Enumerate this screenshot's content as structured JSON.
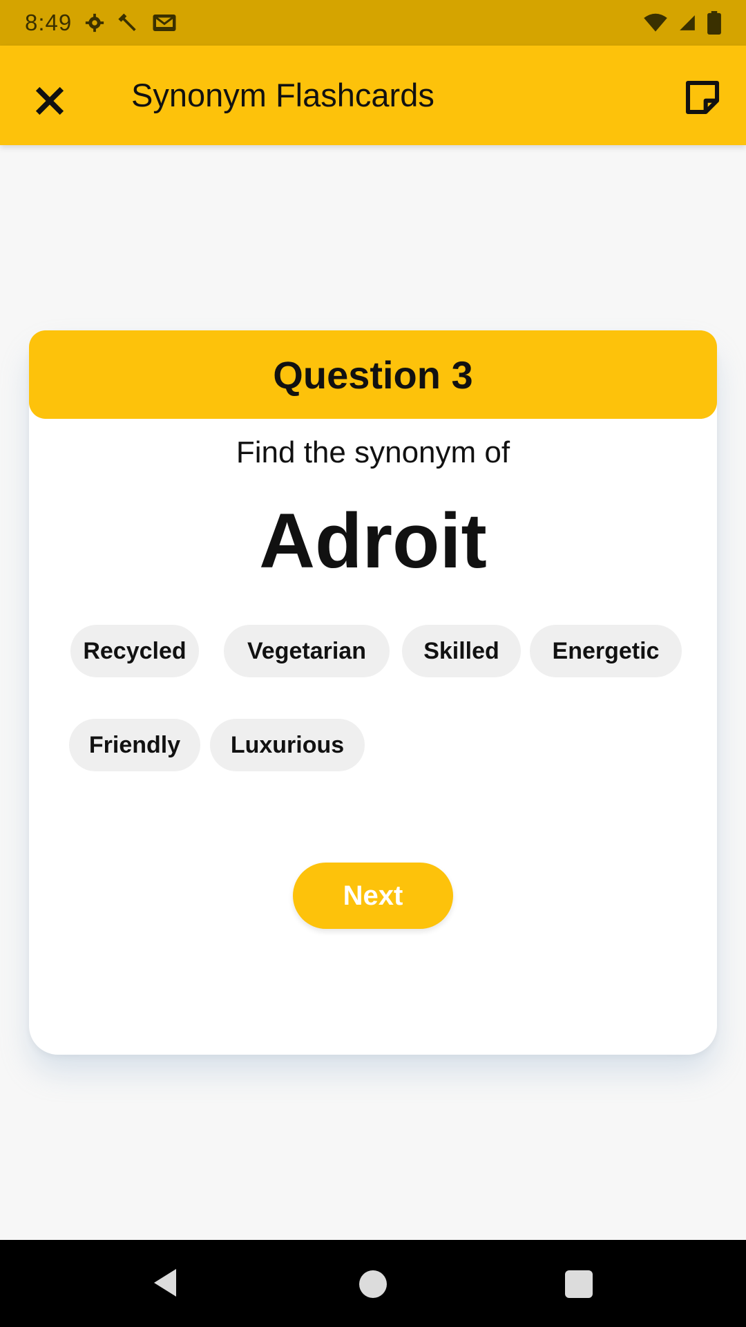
{
  "status_bar": {
    "time": "8:49",
    "left_icons": [
      "gear-icon",
      "wrench-icon",
      "mail-icon"
    ],
    "right_icons": [
      "wifi-icon",
      "signal-icon",
      "battery-icon"
    ]
  },
  "app_bar": {
    "title": "Synonym Flashcards",
    "close_icon": "close-icon",
    "note_icon": "note-icon",
    "background": "#fdc20b"
  },
  "card": {
    "header": "Question 3",
    "prompt": "Find the synonym of",
    "word": "Adroit",
    "options": [
      "Recycled",
      "Vegetarian",
      "Skilled",
      "Energetic",
      "Friendly",
      "Luxurious"
    ],
    "next_label": "Next"
  },
  "nav_bar": {
    "icons": [
      "back-icon",
      "home-icon",
      "recents-icon"
    ]
  },
  "colors": {
    "accent": "#fdc20b",
    "status_bar": "#d5a400",
    "chip": "#efefef"
  }
}
